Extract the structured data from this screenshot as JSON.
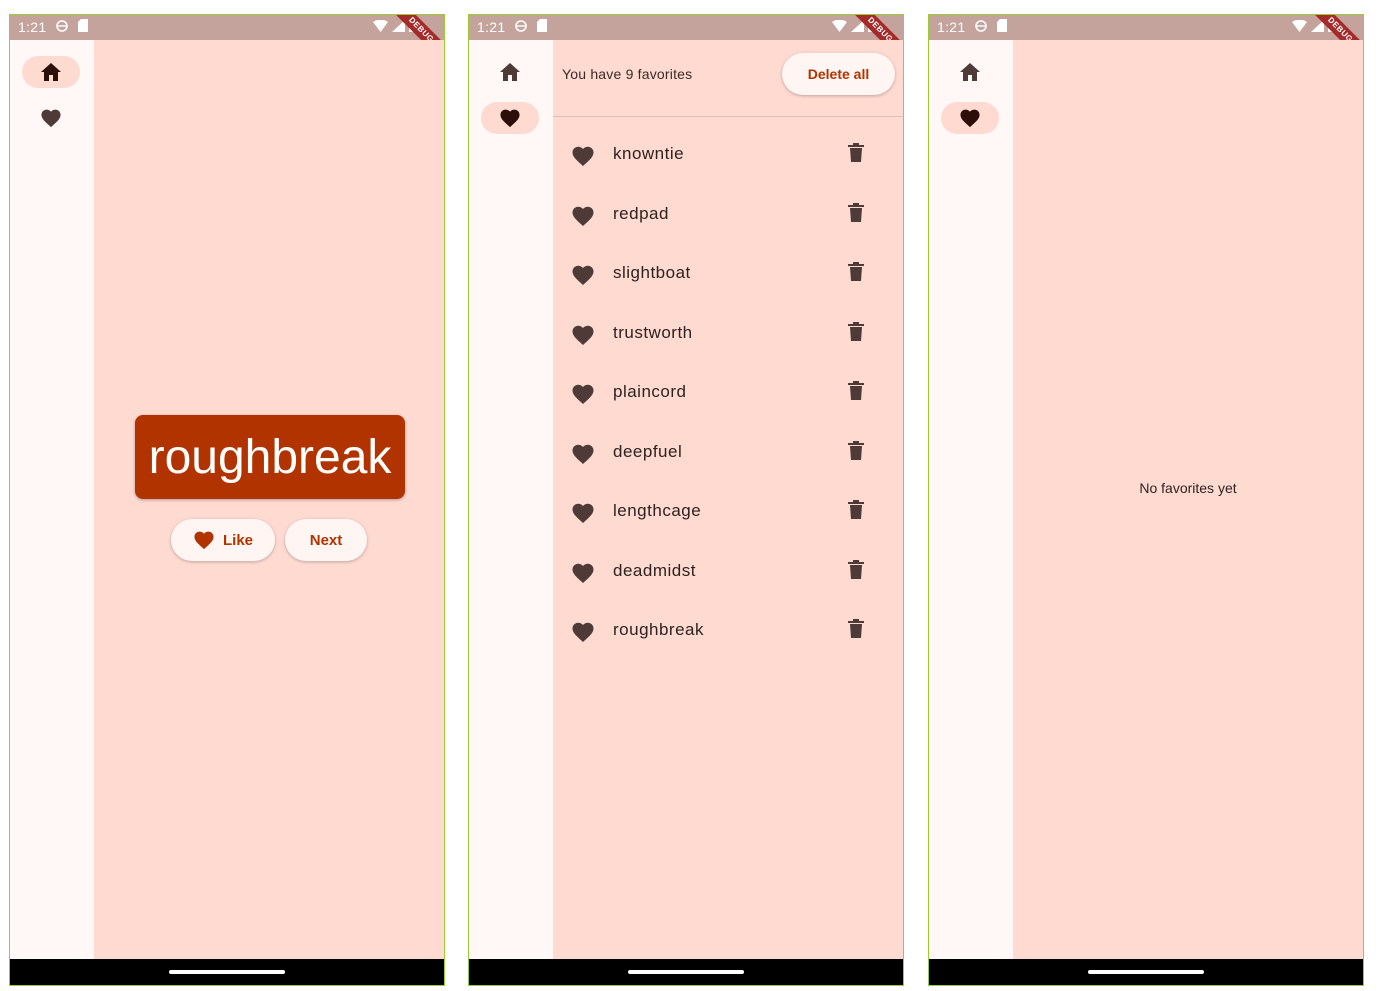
{
  "colors": {
    "primary": "#b13300",
    "background": "#ffdad1",
    "rail_background": "#fff8f7",
    "status_bar": "#c4a39c",
    "icon": "#4e3b37",
    "selected_icon": "#2b0f08"
  },
  "status_bar": {
    "time": "1:21",
    "debug_label": "DEBUG"
  },
  "rail": {
    "home_icon": "home-icon",
    "favorites_icon": "heart-icon"
  },
  "generator": {
    "current_word": "roughbreak",
    "like_label": "Like",
    "next_label": "Next"
  },
  "favorites": {
    "header": "You have 9 favorites",
    "delete_all_label": "Delete all",
    "items": [
      {
        "name": "knowntie"
      },
      {
        "name": "redpad"
      },
      {
        "name": "slightboat"
      },
      {
        "name": "trustworth"
      },
      {
        "name": "plaincord"
      },
      {
        "name": "deepfuel"
      },
      {
        "name": "lengthcage"
      },
      {
        "name": "deadmidst"
      },
      {
        "name": "roughbreak"
      }
    ]
  },
  "empty_favorites": {
    "message": "No favorites yet"
  }
}
